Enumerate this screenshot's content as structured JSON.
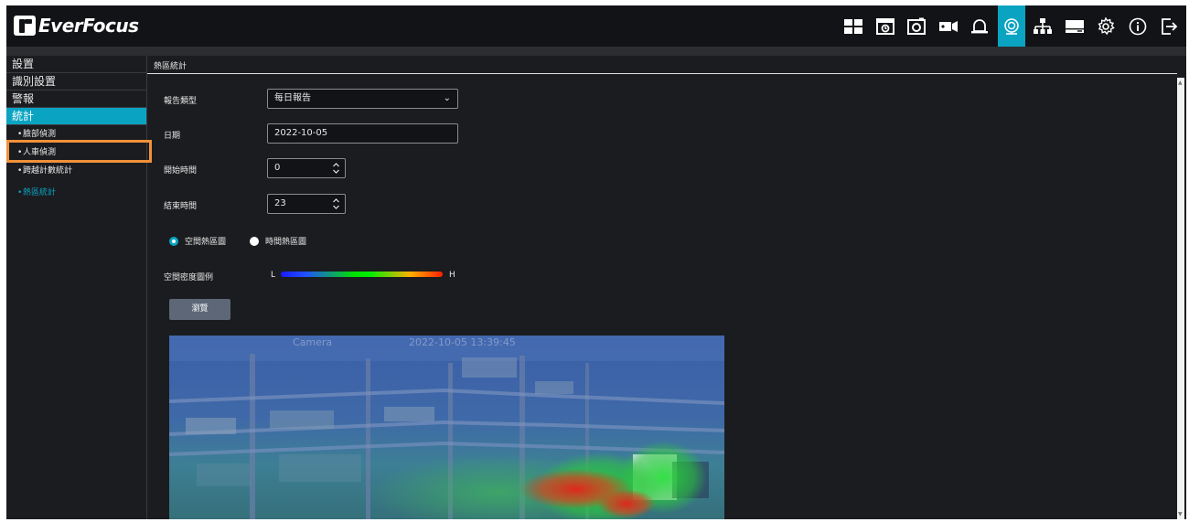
{
  "header": {
    "brand": "EverFocus",
    "toolbar": [
      {
        "icon": "live-view-grid-icon",
        "active": false
      },
      {
        "icon": "playback-icon",
        "active": false
      },
      {
        "icon": "snapshot-icon",
        "active": false
      },
      {
        "icon": "camera-icon",
        "active": false
      },
      {
        "icon": "alarm-bell-icon",
        "active": false
      },
      {
        "icon": "ai-analytics-icon",
        "active": true
      },
      {
        "icon": "network-icon",
        "active": false
      },
      {
        "icon": "storage-icon",
        "active": false
      },
      {
        "icon": "settings-icon",
        "active": false
      },
      {
        "icon": "info-icon",
        "active": false
      },
      {
        "icon": "logout-icon",
        "active": false
      }
    ],
    "accent": "#0aa4c2"
  },
  "sidebar": {
    "items": [
      {
        "label": "設置"
      },
      {
        "label": "識別設置"
      },
      {
        "label": "警報"
      },
      {
        "label": "統計"
      }
    ],
    "subitems": [
      {
        "label": "臉部偵測"
      },
      {
        "label": "人車偵測"
      },
      {
        "label": "跨越計數統計"
      },
      {
        "label": "熱區統計"
      }
    ],
    "highlight_color": "#f0913a"
  },
  "main": {
    "title": "熱區統計",
    "form": {
      "report_type_label": "報告類型",
      "report_type_value": "每日報告",
      "date_label": "日期",
      "date_value": "2022-10-05",
      "start_time_label": "開始時間",
      "start_time_value": "0",
      "end_time_label": "結束時間",
      "end_time_value": "23"
    },
    "radios": {
      "space_label": "空間熱區圖",
      "time_label": "時間熱區圖",
      "selected": "space"
    },
    "legend": {
      "label": "空間密度圖例",
      "low": "L",
      "high": "H"
    },
    "view_button": "瀏覽",
    "heatmap": {
      "camera_text": "Camera",
      "timestamp": "2022-10-05 13:39:45"
    }
  }
}
